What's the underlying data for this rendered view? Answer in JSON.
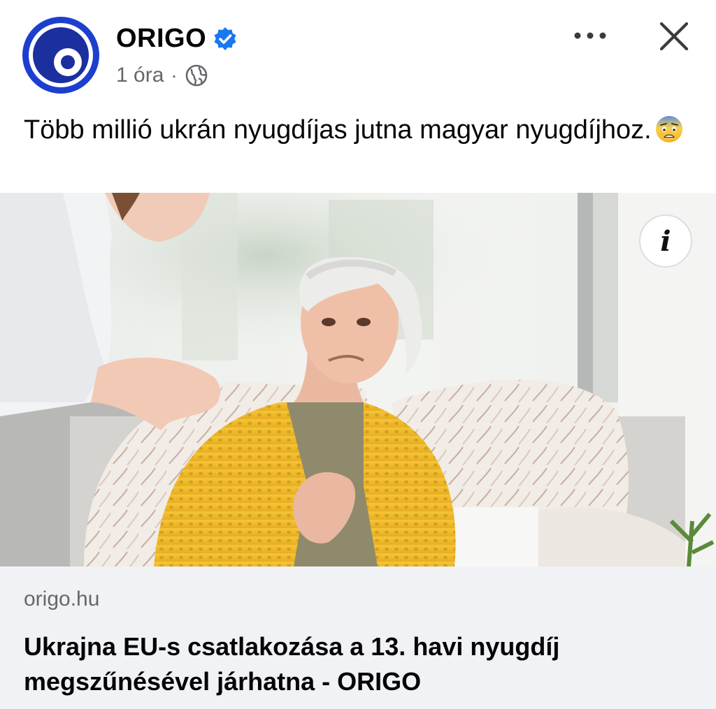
{
  "post": {
    "page_name": "ORIGO",
    "time": "1 óra",
    "separator": "·",
    "audience_icon": "globe-icon",
    "verified_icon": "verified-badge-icon",
    "text": "Több millió ukrán nyugdíjas jutna magyar nyugdíjhoz.",
    "emoji": "anxious-face-emoji"
  },
  "header_actions": {
    "more_icon": "more-horizontal-icon",
    "close_icon": "close-icon"
  },
  "link_preview": {
    "image_description_icon": "info-icon",
    "info_glyph": "i",
    "domain": "origo.hu",
    "title": "Ukrajna EU-s csatlakozása a 13. havi nyugdíj megszűnésével járhatna - ORIGO"
  },
  "colors": {
    "brand_blue": "#1d3fcf",
    "verified_blue": "#1877f2",
    "secondary_text": "#65676b",
    "card_background": "#f0f2f5"
  }
}
